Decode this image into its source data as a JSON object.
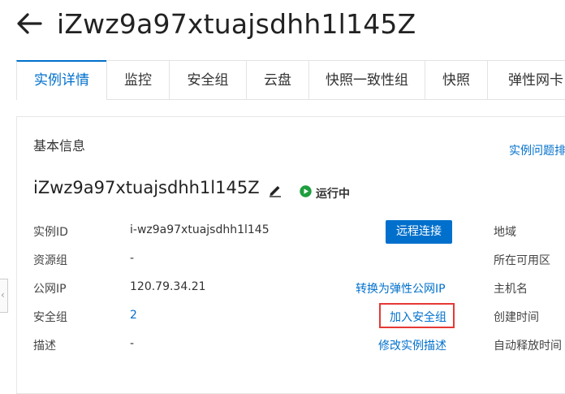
{
  "header": {
    "title": "iZwz9a97xtuajsdhh1l145Z"
  },
  "tabs": [
    {
      "label": "实例详情",
      "active": true
    },
    {
      "label": "监控"
    },
    {
      "label": "安全组"
    },
    {
      "label": "云盘"
    },
    {
      "label": "快照一致性组"
    },
    {
      "label": "快照"
    },
    {
      "label": "弹性网卡"
    }
  ],
  "basic_info": {
    "section_title": "基本信息",
    "diagnose_link": "实例问题排",
    "instance_name": "iZwz9a97xtuajsdhh1l145Z",
    "status": "运行中",
    "status_color": "#1e9e3e",
    "rows": {
      "instance_id": {
        "label": "实例ID",
        "value": "i-wz9a97xtuajsdhh1l145"
      },
      "resource_group": {
        "label": "资源组",
        "value": "-"
      },
      "public_ip": {
        "label": "公网IP",
        "value": "120.79.34.21"
      },
      "security_group": {
        "label": "安全组",
        "value": "2"
      },
      "description": {
        "label": "描述",
        "value": "-"
      }
    },
    "actions": {
      "remote_connect": "远程连接",
      "convert_eip": "转换为弹性公网IP",
      "join_security_group": "加入安全组",
      "edit_description": "修改实例描述"
    },
    "right_labels": {
      "region": "地域",
      "zone": "所在可用区",
      "hostname": "主机名",
      "created": "创建时间",
      "auto_release": "自动释放时间"
    }
  },
  "colors": {
    "accent": "#0070cc",
    "highlight_border": "#e53935"
  }
}
